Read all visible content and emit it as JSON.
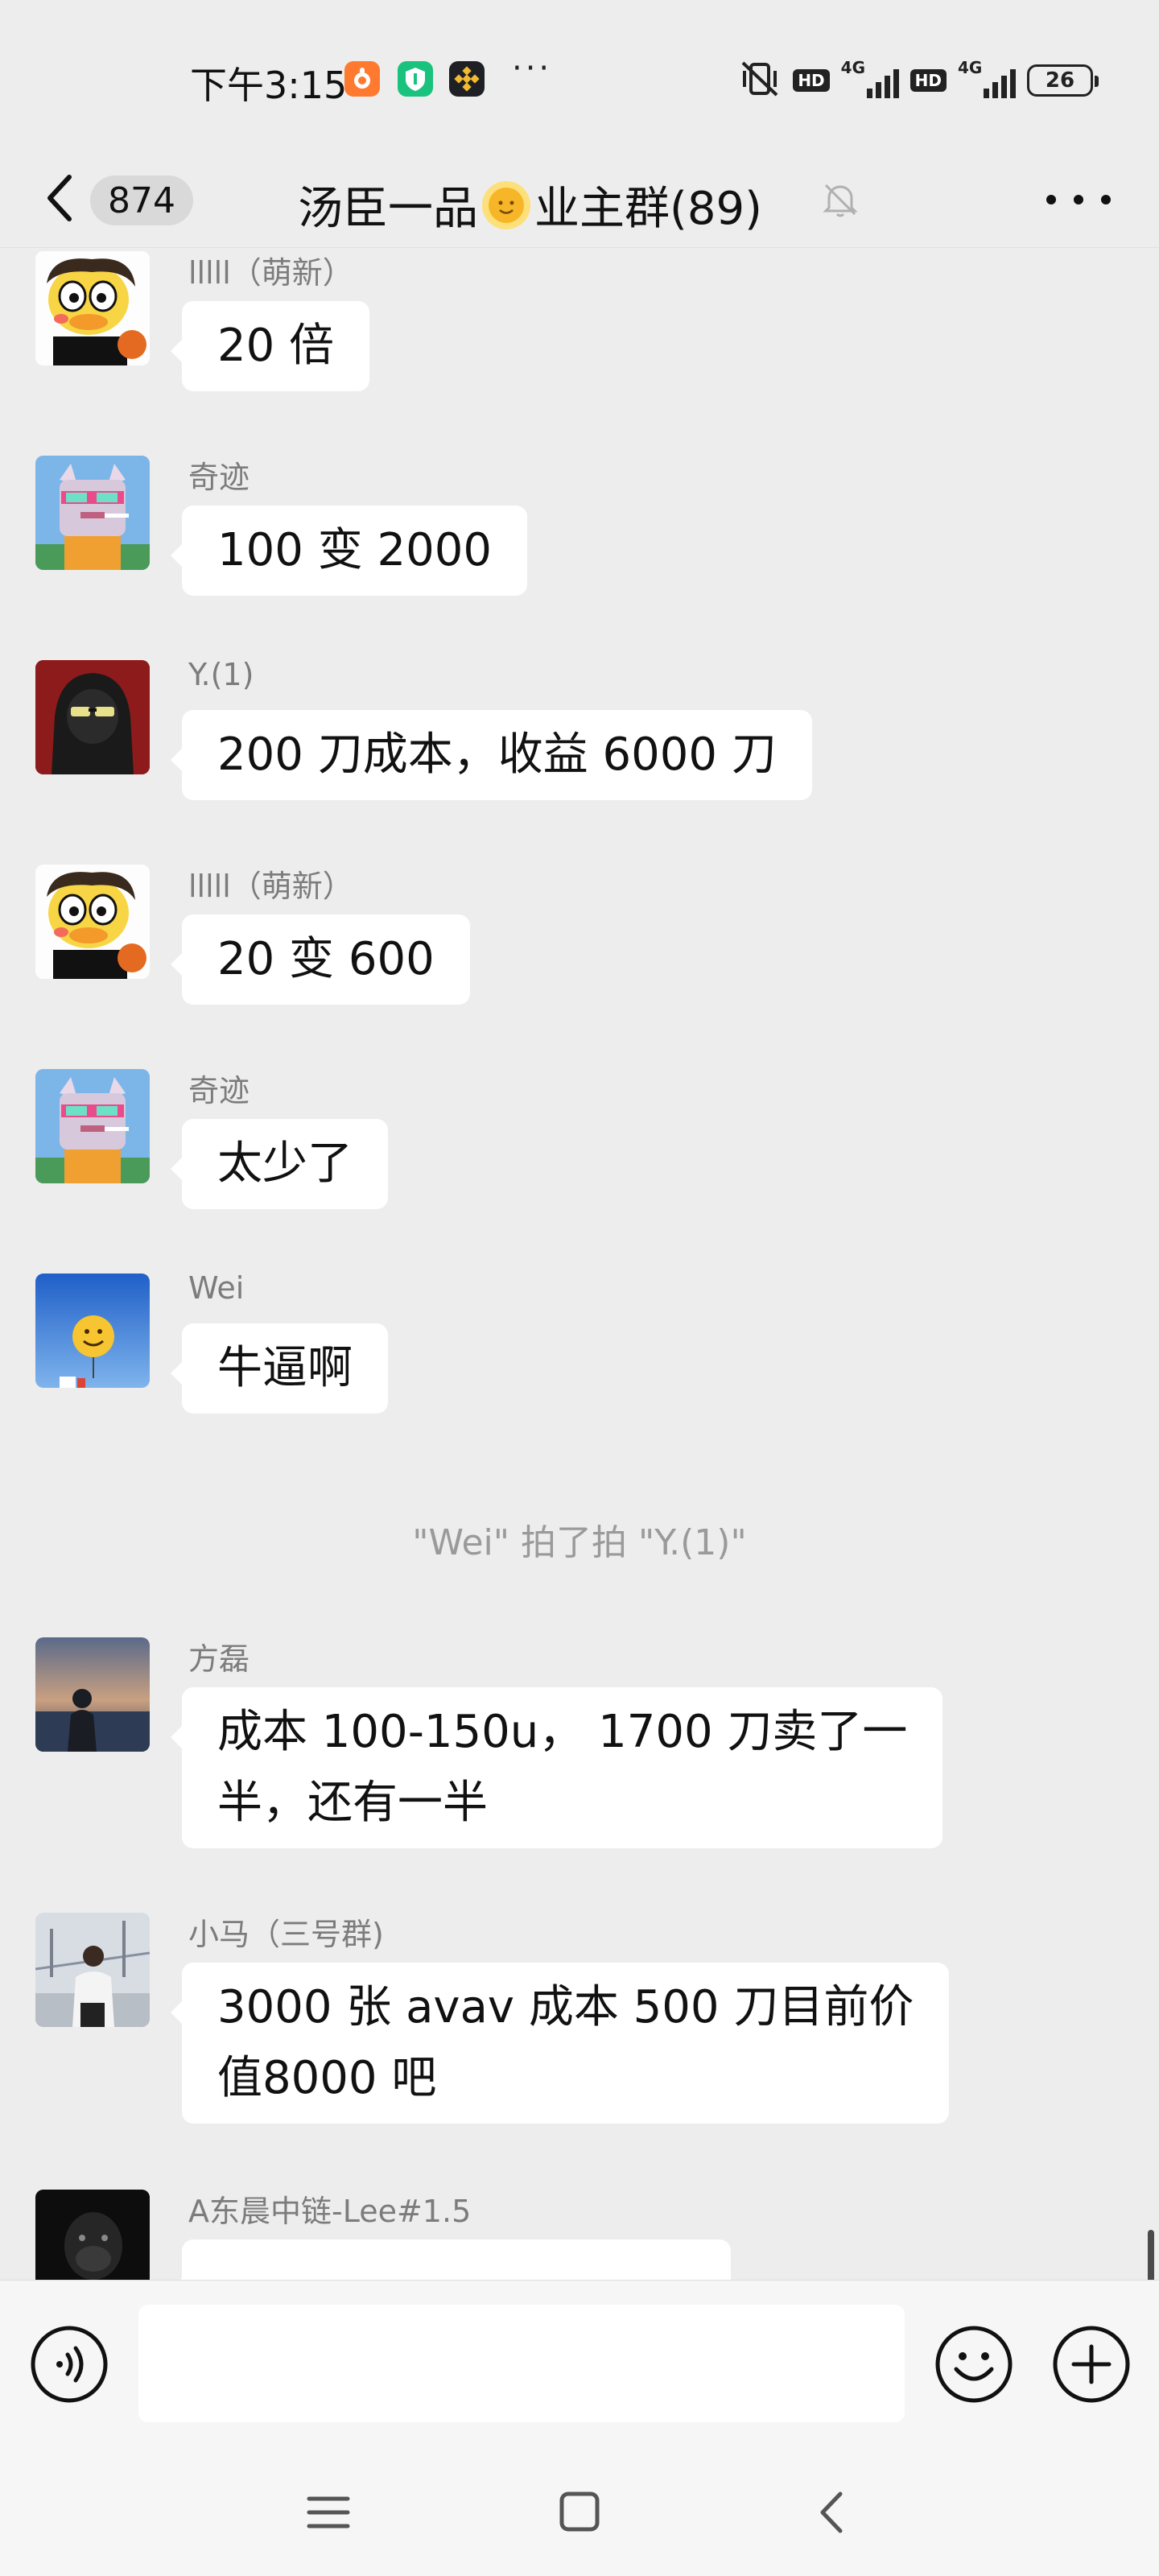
{
  "status_bar": {
    "time": "下午3:15",
    "network_1": "4G",
    "network_2": "4G",
    "hd_1": "HD",
    "hd_2": "HD",
    "battery": "26",
    "more": "···"
  },
  "header": {
    "unread_count": "874",
    "title_left": "汤臣一品",
    "title_right": "业主群(89)",
    "emoji": "sun-with-face"
  },
  "messages": [
    {
      "sender": "lllll（萌新）",
      "text": "20 倍",
      "avatar": "duck-avatar"
    },
    {
      "sender": "奇迹",
      "text": "100 变 2000",
      "avatar": "pixel-cat-avatar"
    },
    {
      "sender": "Y.(1)",
      "text": "200 刀成本，收益 6000 刀",
      "avatar": "hooded-figure-avatar"
    },
    {
      "sender": "lllll（萌新）",
      "text": "20 变 600",
      "avatar": "duck-avatar"
    },
    {
      "sender": "奇迹",
      "text": "太少了",
      "avatar": "pixel-cat-avatar"
    },
    {
      "sender": "Wei",
      "text": "牛逼啊",
      "avatar": "smiley-balloon-avatar"
    },
    {
      "sender": "方磊",
      "text_line1": "成本 100-150u， 1700 刀卖了一",
      "text_line2": "半，还有一半",
      "avatar": "sunset-silhouette-avatar"
    },
    {
      "sender": "小马（三号群)",
      "text_line1": "3000 张 avav 成本 500 刀目前价",
      "text_line2": "值8000 吧",
      "avatar": "man-by-bridge-avatar"
    },
    {
      "sender": "A东晨中链-Lee#1.5",
      "text": "",
      "avatar": "dark-ape-avatar"
    }
  ],
  "system_message": "\"Wei\" 拍了拍 \"Y.(1)\"",
  "input_bar": {
    "placeholder": ""
  },
  "colors": {
    "background": "#ededed",
    "bubble": "#ffffff",
    "sender_text": "#7c7c7c",
    "system_text": "#9a9a9a"
  }
}
